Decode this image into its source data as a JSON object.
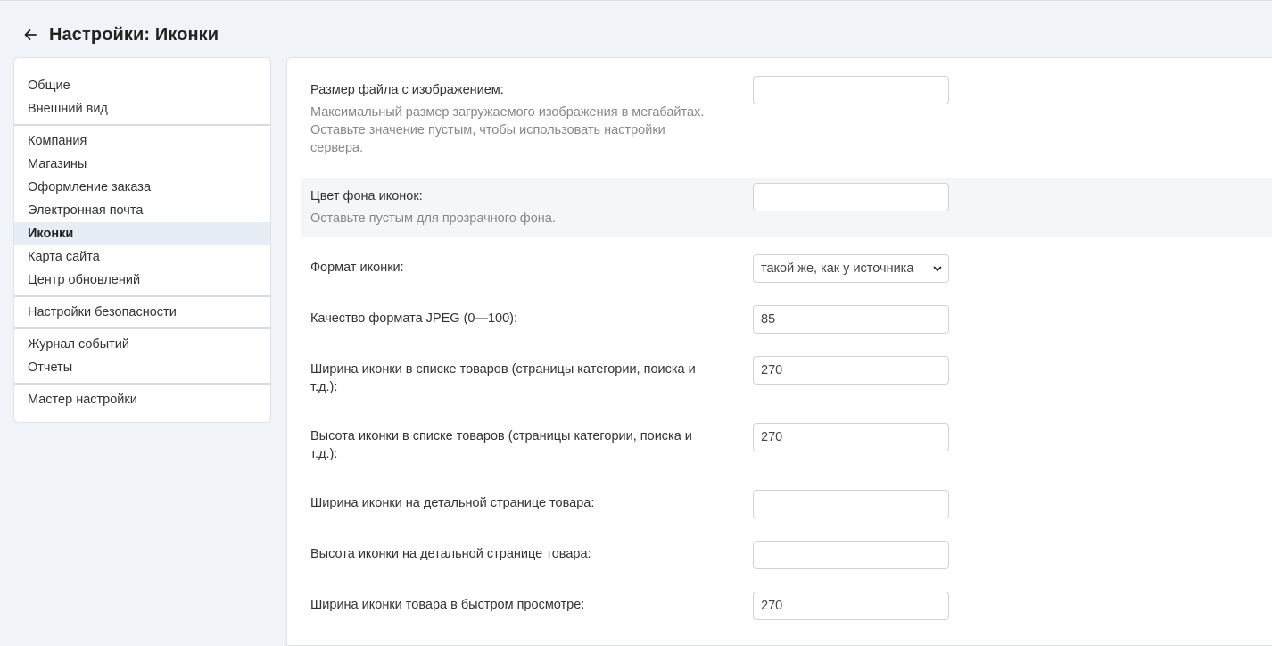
{
  "header": {
    "title": "Настройки: Иконки",
    "back_icon": "arrow-left-icon"
  },
  "sidebar": {
    "groups": [
      {
        "items": [
          {
            "label": "Общие"
          },
          {
            "label": "Внешний вид"
          }
        ]
      },
      {
        "items": [
          {
            "label": "Компания"
          },
          {
            "label": "Магазины"
          },
          {
            "label": "Оформление заказа"
          },
          {
            "label": "Электронная почта"
          },
          {
            "label": "Иконки",
            "active": true
          },
          {
            "label": "Карта сайта"
          },
          {
            "label": "Центр обновлений"
          }
        ]
      },
      {
        "items": [
          {
            "label": "Настройки безопасности"
          }
        ]
      },
      {
        "items": [
          {
            "label": "Журнал событий"
          },
          {
            "label": "Отчеты"
          }
        ]
      },
      {
        "items": [
          {
            "label": "Мастер настройки"
          }
        ]
      }
    ]
  },
  "form": {
    "file_size": {
      "label": "Размер файла с изображением:",
      "hint": "Максимальный размер загружаемого изображения в мегабайтах. Оставьте значение пустым, чтобы использовать настройки сервера.",
      "value": ""
    },
    "bg_color": {
      "label": "Цвет фона иконок:",
      "hint": "Оставьте пустым для прозрачного фона.",
      "value": ""
    },
    "format": {
      "label": "Формат иконки:",
      "value": "такой же, как у источника"
    },
    "jpeg_quality": {
      "label": "Качество формата JPEG (0—100):",
      "value": "85"
    },
    "list_width": {
      "label": "Ширина иконки в списке товаров (страницы категории, поиска и т.д.):",
      "value": "270"
    },
    "list_height": {
      "label": "Высота иконки в списке товаров (страницы категории, поиска и т.д.):",
      "value": "270"
    },
    "detail_width": {
      "label": "Ширина иконки на детальной странице товара:",
      "value": ""
    },
    "detail_height": {
      "label": "Высота иконки на детальной странице товара:",
      "value": ""
    },
    "quick_width": {
      "label": "Ширина иконки товара в быстром просмотре:",
      "value": "270"
    }
  },
  "colors": {
    "active_bg": "#e6edf5",
    "page_bg": "#f0f3f7",
    "hint": "#888888"
  }
}
